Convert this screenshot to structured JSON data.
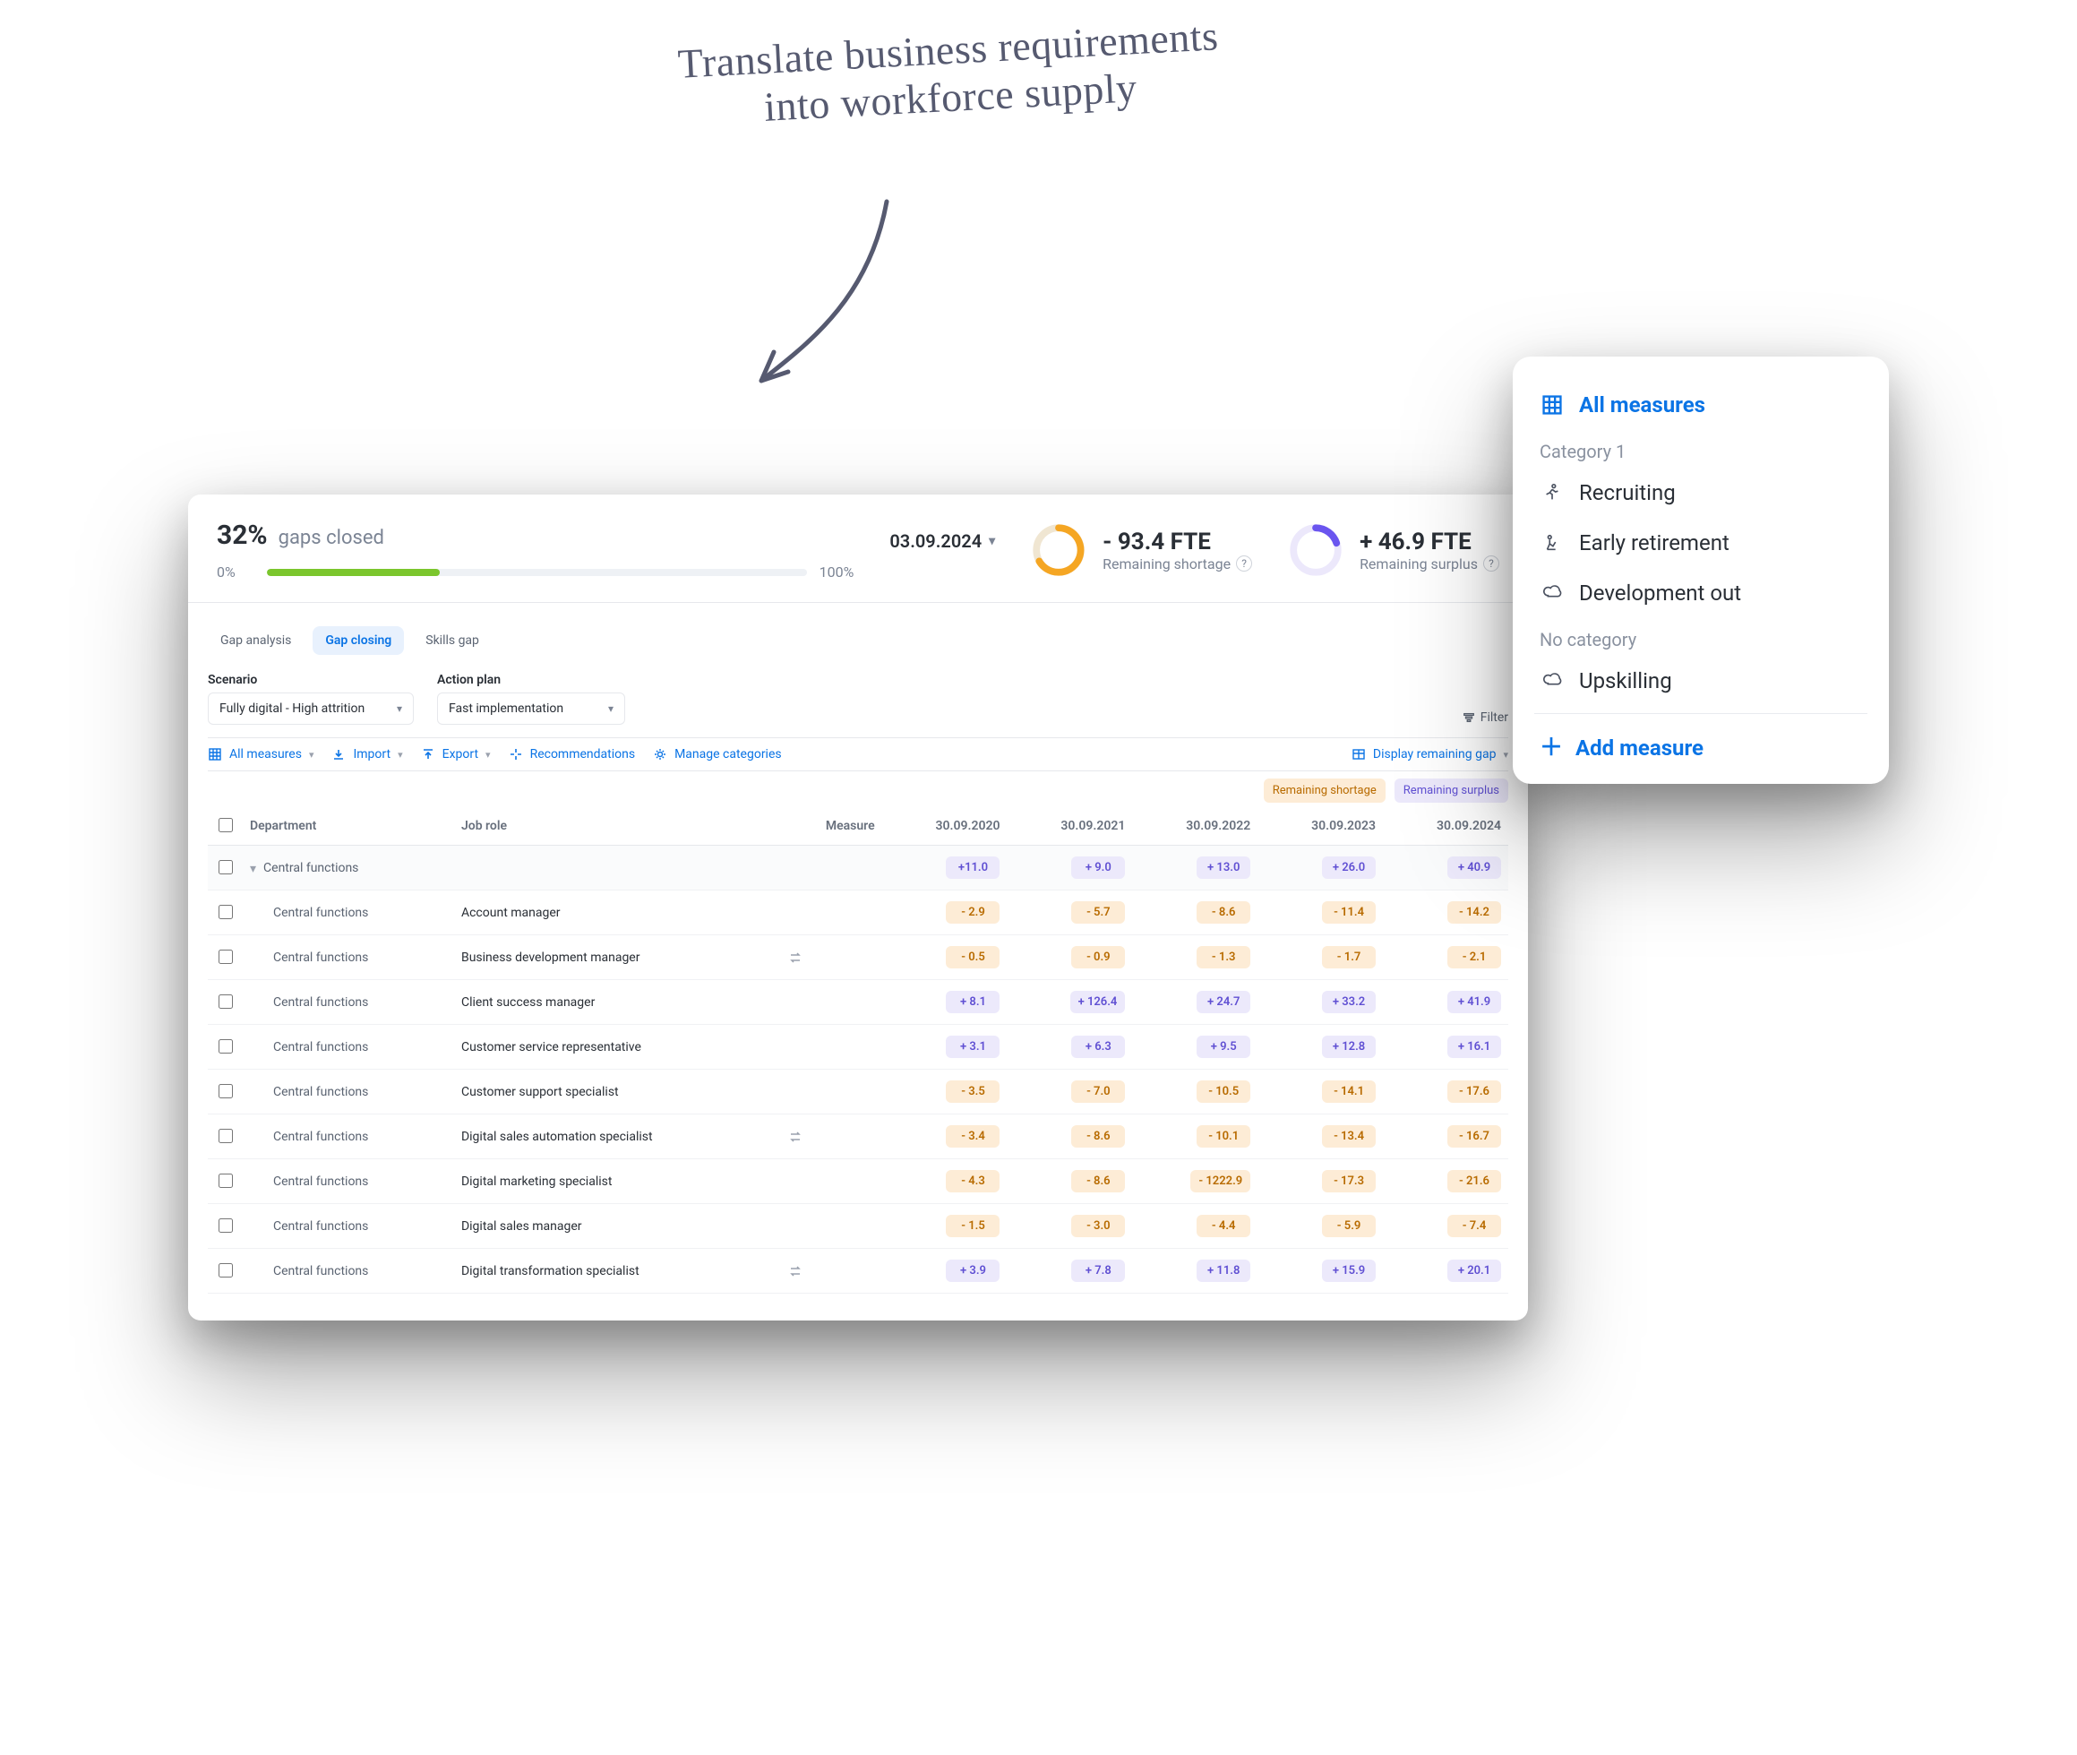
{
  "annotation": {
    "line1": "Translate business requirements",
    "line2": "into workforce supply"
  },
  "header": {
    "gaps_value": "32%",
    "gaps_label": "gaps closed",
    "progress": {
      "left": "0%",
      "right": "100%",
      "fill_pct": 32
    },
    "date": "03.09.2024",
    "shortage": {
      "value": "- 93.4 FTE",
      "caption": "Remaining shortage"
    },
    "surplus": {
      "value": "+ 46.9 FTE",
      "caption": "Remaining surplus"
    }
  },
  "tabs": {
    "gap_analysis": "Gap analysis",
    "gap_closing": "Gap closing",
    "skills_gap": "Skills gap"
  },
  "selectors": {
    "scenario_label": "Scenario",
    "scenario_value": "Fully digital - High attrition",
    "plan_label": "Action plan",
    "plan_value": "Fast implementation",
    "filter": "Filter"
  },
  "toolbar": {
    "all_measures": "All measures",
    "import": "Import",
    "export": "Export",
    "recommendations": "Recommendations",
    "manage": "Manage categories",
    "display": "Display remaining gap"
  },
  "legend": {
    "shortage": "Remaining shortage",
    "surplus": "Remaining surplus"
  },
  "columns": {
    "department": "Department",
    "role": "Job role",
    "measure": "Measure",
    "y2020": "30.09.2020",
    "y2021": "30.09.2021",
    "y2022": "30.09.2022",
    "y2023": "30.09.2023",
    "y2024": "30.09.2024"
  },
  "group": {
    "department": "Central functions",
    "vals": [
      "+11.0",
      "+ 9.0",
      "+ 13.0",
      "+ 26.0",
      "+ 40.9"
    ]
  },
  "rows": [
    {
      "department": "Central functions",
      "role": "Account manager",
      "swap": false,
      "vals": [
        "- 2.9",
        "- 5.7",
        "- 8.6",
        "- 11.4",
        "- 14.2"
      ]
    },
    {
      "department": "Central functions",
      "role": "Business development manager",
      "swap": true,
      "vals": [
        "- 0.5",
        "- 0.9",
        "- 1.3",
        "- 1.7",
        "- 2.1"
      ]
    },
    {
      "department": "Central functions",
      "role": "Client success manager",
      "swap": false,
      "vals": [
        "+ 8.1",
        "+ 126.4",
        "+ 24.7",
        "+ 33.2",
        "+ 41.9"
      ]
    },
    {
      "department": "Central functions",
      "role": "Customer service representative",
      "swap": false,
      "vals": [
        "+ 3.1",
        "+ 6.3",
        "+ 9.5",
        "+ 12.8",
        "+ 16.1"
      ]
    },
    {
      "department": "Central functions",
      "role": "Customer support specialist",
      "swap": false,
      "vals": [
        "- 3.5",
        "- 7.0",
        "- 10.5",
        "- 14.1",
        "- 17.6"
      ]
    },
    {
      "department": "Central functions",
      "role": "Digital sales automation specialist",
      "swap": true,
      "vals": [
        "- 3.4",
        "- 8.6",
        "- 10.1",
        "- 13.4",
        "- 16.7"
      ]
    },
    {
      "department": "Central functions",
      "role": "Digital marketing specialist",
      "swap": false,
      "vals": [
        "- 4.3",
        "- 8.6",
        "- 1222.9",
        "- 17.3",
        "- 21.6"
      ]
    },
    {
      "department": "Central functions",
      "role": "Digital sales manager",
      "swap": false,
      "vals": [
        "- 1.5",
        "- 3.0",
        "- 4.4",
        "- 5.9",
        "- 7.4"
      ]
    },
    {
      "department": "Central functions",
      "role": "Digital transformation specialist",
      "swap": true,
      "vals": [
        "+ 3.9",
        "+ 7.8",
        "+ 11.8",
        "+ 15.9",
        "+ 20.1"
      ]
    }
  ],
  "popover": {
    "all": "All measures",
    "cat1": "Category 1",
    "items1": [
      {
        "icon": "run",
        "label": "Recruiting"
      },
      {
        "icon": "retire",
        "label": "Early retirement"
      },
      {
        "icon": "cloud",
        "label": "Development out"
      }
    ],
    "nocat": "No category",
    "items2": [
      {
        "icon": "cloud",
        "label": "Upskilling"
      }
    ],
    "add": "Add measure"
  }
}
